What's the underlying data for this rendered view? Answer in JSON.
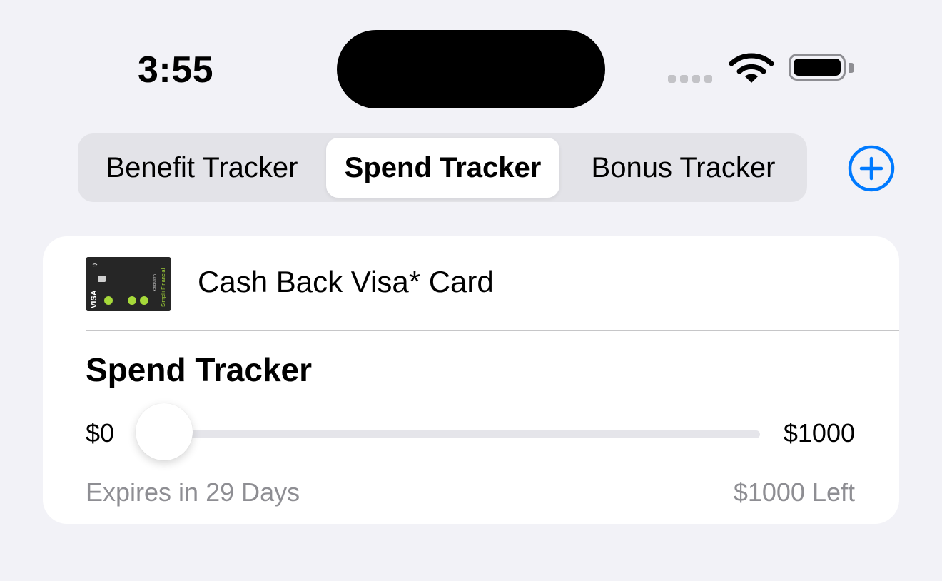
{
  "status_bar": {
    "time": "3:55",
    "icons": [
      "cellular-signal-icon",
      "wifi-icon",
      "battery-icon"
    ]
  },
  "tabs": [
    {
      "label": "Benefit Tracker",
      "selected": false
    },
    {
      "label": "Spend Tracker",
      "selected": true
    },
    {
      "label": "Bonus Tracker",
      "selected": false
    }
  ],
  "add_button": {
    "icon": "plus-circle-icon",
    "color": "#007aff"
  },
  "card": {
    "name": "Cash Back Visa* Card",
    "thumbnail": {
      "brand_text": "VISA",
      "issuer_text": "Simplii Financial",
      "product_text": "Cash Back",
      "dot_color": "#a6d93a"
    },
    "spend_tracker": {
      "title": "Spend Tracker",
      "min_label": "$0",
      "max_label": "$1000",
      "progress_fraction": 0,
      "expires_text": "Expires in 29 Days",
      "remaining_text": "$1000 Left"
    }
  },
  "colors": {
    "background": "#f2f2f7",
    "accent": "#007aff",
    "secondary_text": "#8e8e93"
  }
}
